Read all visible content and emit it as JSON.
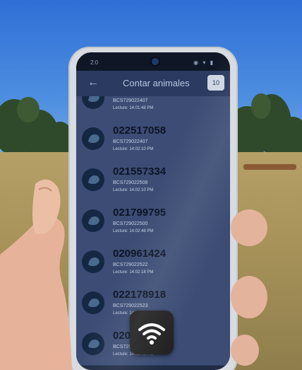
{
  "status_bar": {
    "time": "2:0",
    "icons": "◉ ▾ ▮"
  },
  "app_bar": {
    "back_icon": "arrow-left-icon",
    "title": "Contar animales",
    "count": "10"
  },
  "list": [
    {
      "tag": "",
      "code": "BCS729022407",
      "read": "Lecture: 14:01:48 PM"
    },
    {
      "tag": "022517058",
      "code": "BCS729022407",
      "read": "Lecture: 14:02:10 PM"
    },
    {
      "tag": "021557334",
      "code": "BCS729022508",
      "read": "Lecture: 14:02:10 PM"
    },
    {
      "tag": "021799795",
      "code": "BCS729022500",
      "read": "Lecture: 14:02:48 PM"
    },
    {
      "tag": "020961424",
      "code": "BCS729022522",
      "read": "Lecture: 14:02:18 PM"
    },
    {
      "tag": "022178918",
      "code": "BCS729022523",
      "read": "Lecture: 14:02:18 PM"
    },
    {
      "tag": "0200",
      "code": "BCS729022477",
      "read": "Lecture: 14:02:48 PM"
    }
  ],
  "fab_icon": "wifi-icon",
  "colors": {
    "screen": "#1f2a44",
    "row": "#3c4c74",
    "appbar": "#2a3a60",
    "sky": "#2f6fd6"
  }
}
